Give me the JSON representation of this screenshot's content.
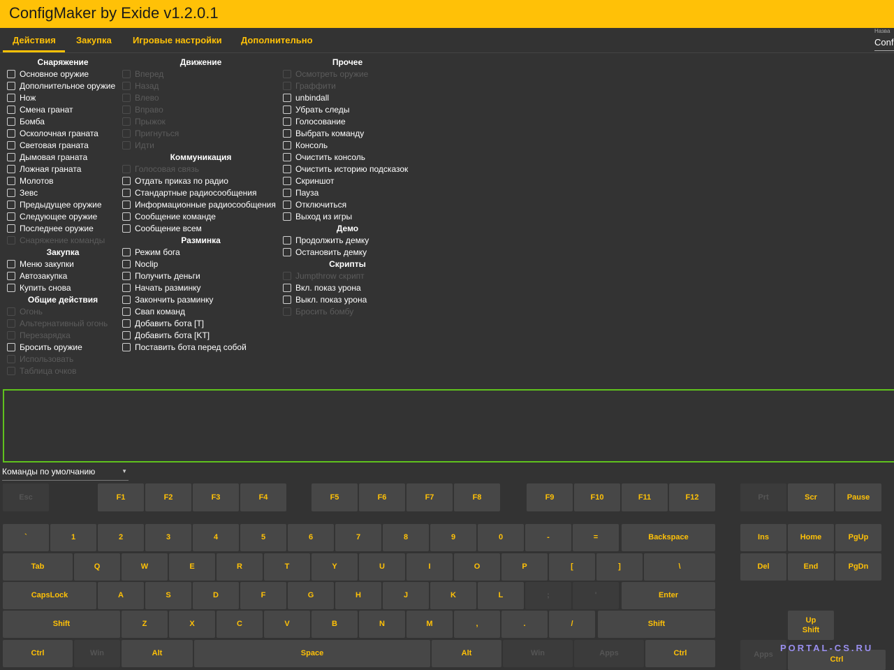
{
  "app": {
    "title": "ConfigMaker by Exide v1.2.0.1"
  },
  "tabs": [
    "Действия",
    "Закупка",
    "Игровые настройки",
    "Дополнительно"
  ],
  "namefield": {
    "label": "Назва",
    "value": "Confi"
  },
  "columns": [
    {
      "sections": [
        {
          "title": "Снаряжение",
          "items": [
            {
              "label": "Основное оружие",
              "enabled": true
            },
            {
              "label": "Дополнительное оружие",
              "enabled": true
            },
            {
              "label": "Нож",
              "enabled": true
            },
            {
              "label": "Смена гранат",
              "enabled": true
            },
            {
              "label": "Бомба",
              "enabled": true
            },
            {
              "label": "Осколочная граната",
              "enabled": true
            },
            {
              "label": "Световая граната",
              "enabled": true
            },
            {
              "label": "Дымовая граната",
              "enabled": true
            },
            {
              "label": "Ложная граната",
              "enabled": true
            },
            {
              "label": "Молотов",
              "enabled": true
            },
            {
              "label": "Зевс",
              "enabled": true
            },
            {
              "label": "Предыдущее оружие",
              "enabled": true
            },
            {
              "label": "Следующее оружие",
              "enabled": true
            },
            {
              "label": "Последнее оружие",
              "enabled": true
            },
            {
              "label": "Снаряжение команды",
              "enabled": false
            }
          ]
        },
        {
          "title": "Закупка",
          "items": [
            {
              "label": "Меню закупки",
              "enabled": true
            },
            {
              "label": "Автозакупка",
              "enabled": true
            },
            {
              "label": "Купить снова",
              "enabled": true
            }
          ]
        },
        {
          "title": "Общие действия",
          "items": [
            {
              "label": "Огонь",
              "enabled": false
            },
            {
              "label": "Альтернативный огонь",
              "enabled": false
            },
            {
              "label": "Перезарядка",
              "enabled": false
            },
            {
              "label": "Бросить оружие",
              "enabled": true
            },
            {
              "label": "Использовать",
              "enabled": false
            },
            {
              "label": "Таблица очков",
              "enabled": false
            }
          ]
        }
      ]
    },
    {
      "sections": [
        {
          "title": "Движение",
          "items": [
            {
              "label": "Вперед",
              "enabled": false
            },
            {
              "label": "Назад",
              "enabled": false
            },
            {
              "label": "Влево",
              "enabled": false
            },
            {
              "label": "Вправо",
              "enabled": false
            },
            {
              "label": "Прыжок",
              "enabled": false
            },
            {
              "label": "Пригнуться",
              "enabled": false
            },
            {
              "label": "Идти",
              "enabled": false
            }
          ]
        },
        {
          "title": "Коммуникация",
          "items": [
            {
              "label": "Голосовая связь",
              "enabled": false
            },
            {
              "label": "Отдать приказ по радио",
              "enabled": true
            },
            {
              "label": "Стандартные радиосообщения",
              "enabled": true
            },
            {
              "label": "Информационные радиосообщения",
              "enabled": true
            },
            {
              "label": "Сообщение команде",
              "enabled": true
            },
            {
              "label": "Сообщение всем",
              "enabled": true
            }
          ]
        },
        {
          "title": "Разминка",
          "items": [
            {
              "label": "Режим бога",
              "enabled": true
            },
            {
              "label": "Noclip",
              "enabled": true
            },
            {
              "label": "Получить деньги",
              "enabled": true
            },
            {
              "label": "Начать разминку",
              "enabled": true
            },
            {
              "label": "Закончить разминку",
              "enabled": true
            },
            {
              "label": "Свап команд",
              "enabled": true
            },
            {
              "label": "Добавить бота [T]",
              "enabled": true
            },
            {
              "label": "Добавить бота [KT]",
              "enabled": true
            },
            {
              "label": "Поставить бота перед собой",
              "enabled": true
            }
          ]
        }
      ]
    },
    {
      "sections": [
        {
          "title": "Прочее",
          "items": [
            {
              "label": "Осмотреть оружие",
              "enabled": false
            },
            {
              "label": "Граффити",
              "enabled": false
            },
            {
              "label": "unbindall",
              "enabled": true
            },
            {
              "label": "Убрать следы",
              "enabled": true
            },
            {
              "label": "Голосование",
              "enabled": true
            },
            {
              "label": "Выбрать команду",
              "enabled": true
            },
            {
              "label": "Консоль",
              "enabled": true
            },
            {
              "label": "Очистить консоль",
              "enabled": true
            },
            {
              "label": "Очистить историю подсказок",
              "enabled": true
            },
            {
              "label": "Скриншот",
              "enabled": true
            },
            {
              "label": "Пауза",
              "enabled": true
            },
            {
              "label": "Отключиться",
              "enabled": true
            },
            {
              "label": "Выход из игры",
              "enabled": true
            }
          ]
        },
        {
          "title": "Демо",
          "items": [
            {
              "label": "Продолжить демку",
              "enabled": true
            },
            {
              "label": "Остановить демку",
              "enabled": true
            }
          ]
        },
        {
          "title": "Скрипты",
          "items": [
            {
              "label": "Jumpthrow скрипт",
              "enabled": false
            },
            {
              "label": "Вкл. показ урона",
              "enabled": true
            },
            {
              "label": "Выкл. показ урона",
              "enabled": true
            },
            {
              "label": "Бросить бомбу",
              "enabled": false
            }
          ]
        }
      ]
    }
  ],
  "preset": {
    "value": "Команды по умолчанию"
  },
  "keyboard": {
    "function_row": [
      {
        "label": "Esc",
        "enabled": false
      },
      {
        "label": "F1",
        "enabled": true
      },
      {
        "label": "F2",
        "enabled": true
      },
      {
        "label": "F3",
        "enabled": true
      },
      {
        "label": "F4",
        "enabled": true
      },
      {
        "label": "F5",
        "enabled": true
      },
      {
        "label": "F6",
        "enabled": true
      },
      {
        "label": "F7",
        "enabled": true
      },
      {
        "label": "F8",
        "enabled": true
      },
      {
        "label": "F9",
        "enabled": true
      },
      {
        "label": "F10",
        "enabled": true
      },
      {
        "label": "F11",
        "enabled": true
      },
      {
        "label": "F12",
        "enabled": true
      },
      {
        "label": "Prt",
        "enabled": false
      },
      {
        "label": "Scr",
        "enabled": true
      },
      {
        "label": "Pause",
        "enabled": true
      }
    ],
    "row1": [
      "`",
      "1",
      "2",
      "3",
      "4",
      "5",
      "6",
      "7",
      "8",
      "9",
      "0",
      "-",
      "=",
      "Backspace"
    ],
    "row2": [
      "Tab",
      "Q",
      "W",
      "E",
      "R",
      "T",
      "Y",
      "U",
      "I",
      "O",
      "P",
      "[",
      "]",
      "\\"
    ],
    "row3": [
      {
        "label": "CapsLock",
        "enabled": true
      },
      {
        "label": "A",
        "enabled": true
      },
      {
        "label": "S",
        "enabled": true
      },
      {
        "label": "D",
        "enabled": true
      },
      {
        "label": "F",
        "enabled": true
      },
      {
        "label": "G",
        "enabled": true
      },
      {
        "label": "H",
        "enabled": true
      },
      {
        "label": "J",
        "enabled": true
      },
      {
        "label": "K",
        "enabled": true
      },
      {
        "label": "L",
        "enabled": true
      },
      {
        "label": ";",
        "enabled": false
      },
      {
        "label": "'",
        "enabled": false
      },
      {
        "label": "Enter",
        "enabled": true
      }
    ],
    "row4": [
      "Shift",
      "Z",
      "X",
      "C",
      "V",
      "B",
      "N",
      "M",
      ",",
      ".",
      "/",
      "Shift"
    ],
    "row5": [
      {
        "label": "Ctrl",
        "enabled": true
      },
      {
        "label": "Win",
        "enabled": false
      },
      {
        "label": "Alt",
        "enabled": true
      },
      {
        "label": "Space",
        "enabled": true
      },
      {
        "label": "Alt",
        "enabled": true
      },
      {
        "label": "Win",
        "enabled": false
      },
      {
        "label": "Apps",
        "enabled": false
      },
      {
        "label": "Ctrl",
        "enabled": true
      }
    ],
    "nav": [
      "Ins",
      "Home",
      "PgUp",
      "Del",
      "End",
      "PgDn"
    ],
    "arrows": [
      {
        "label": "Up",
        "enabled": true
      },
      {
        "label": "Shift",
        "enabled": true
      },
      {
        "label": "Apps",
        "enabled": false
      },
      {
        "label": "Ctrl",
        "enabled": true
      }
    ]
  },
  "watermark": "PORTAL-CS.RU",
  "colors": {
    "accent": "#ffc107",
    "background": "#333333",
    "key": "#474747",
    "console_border": "#5fc21d"
  }
}
